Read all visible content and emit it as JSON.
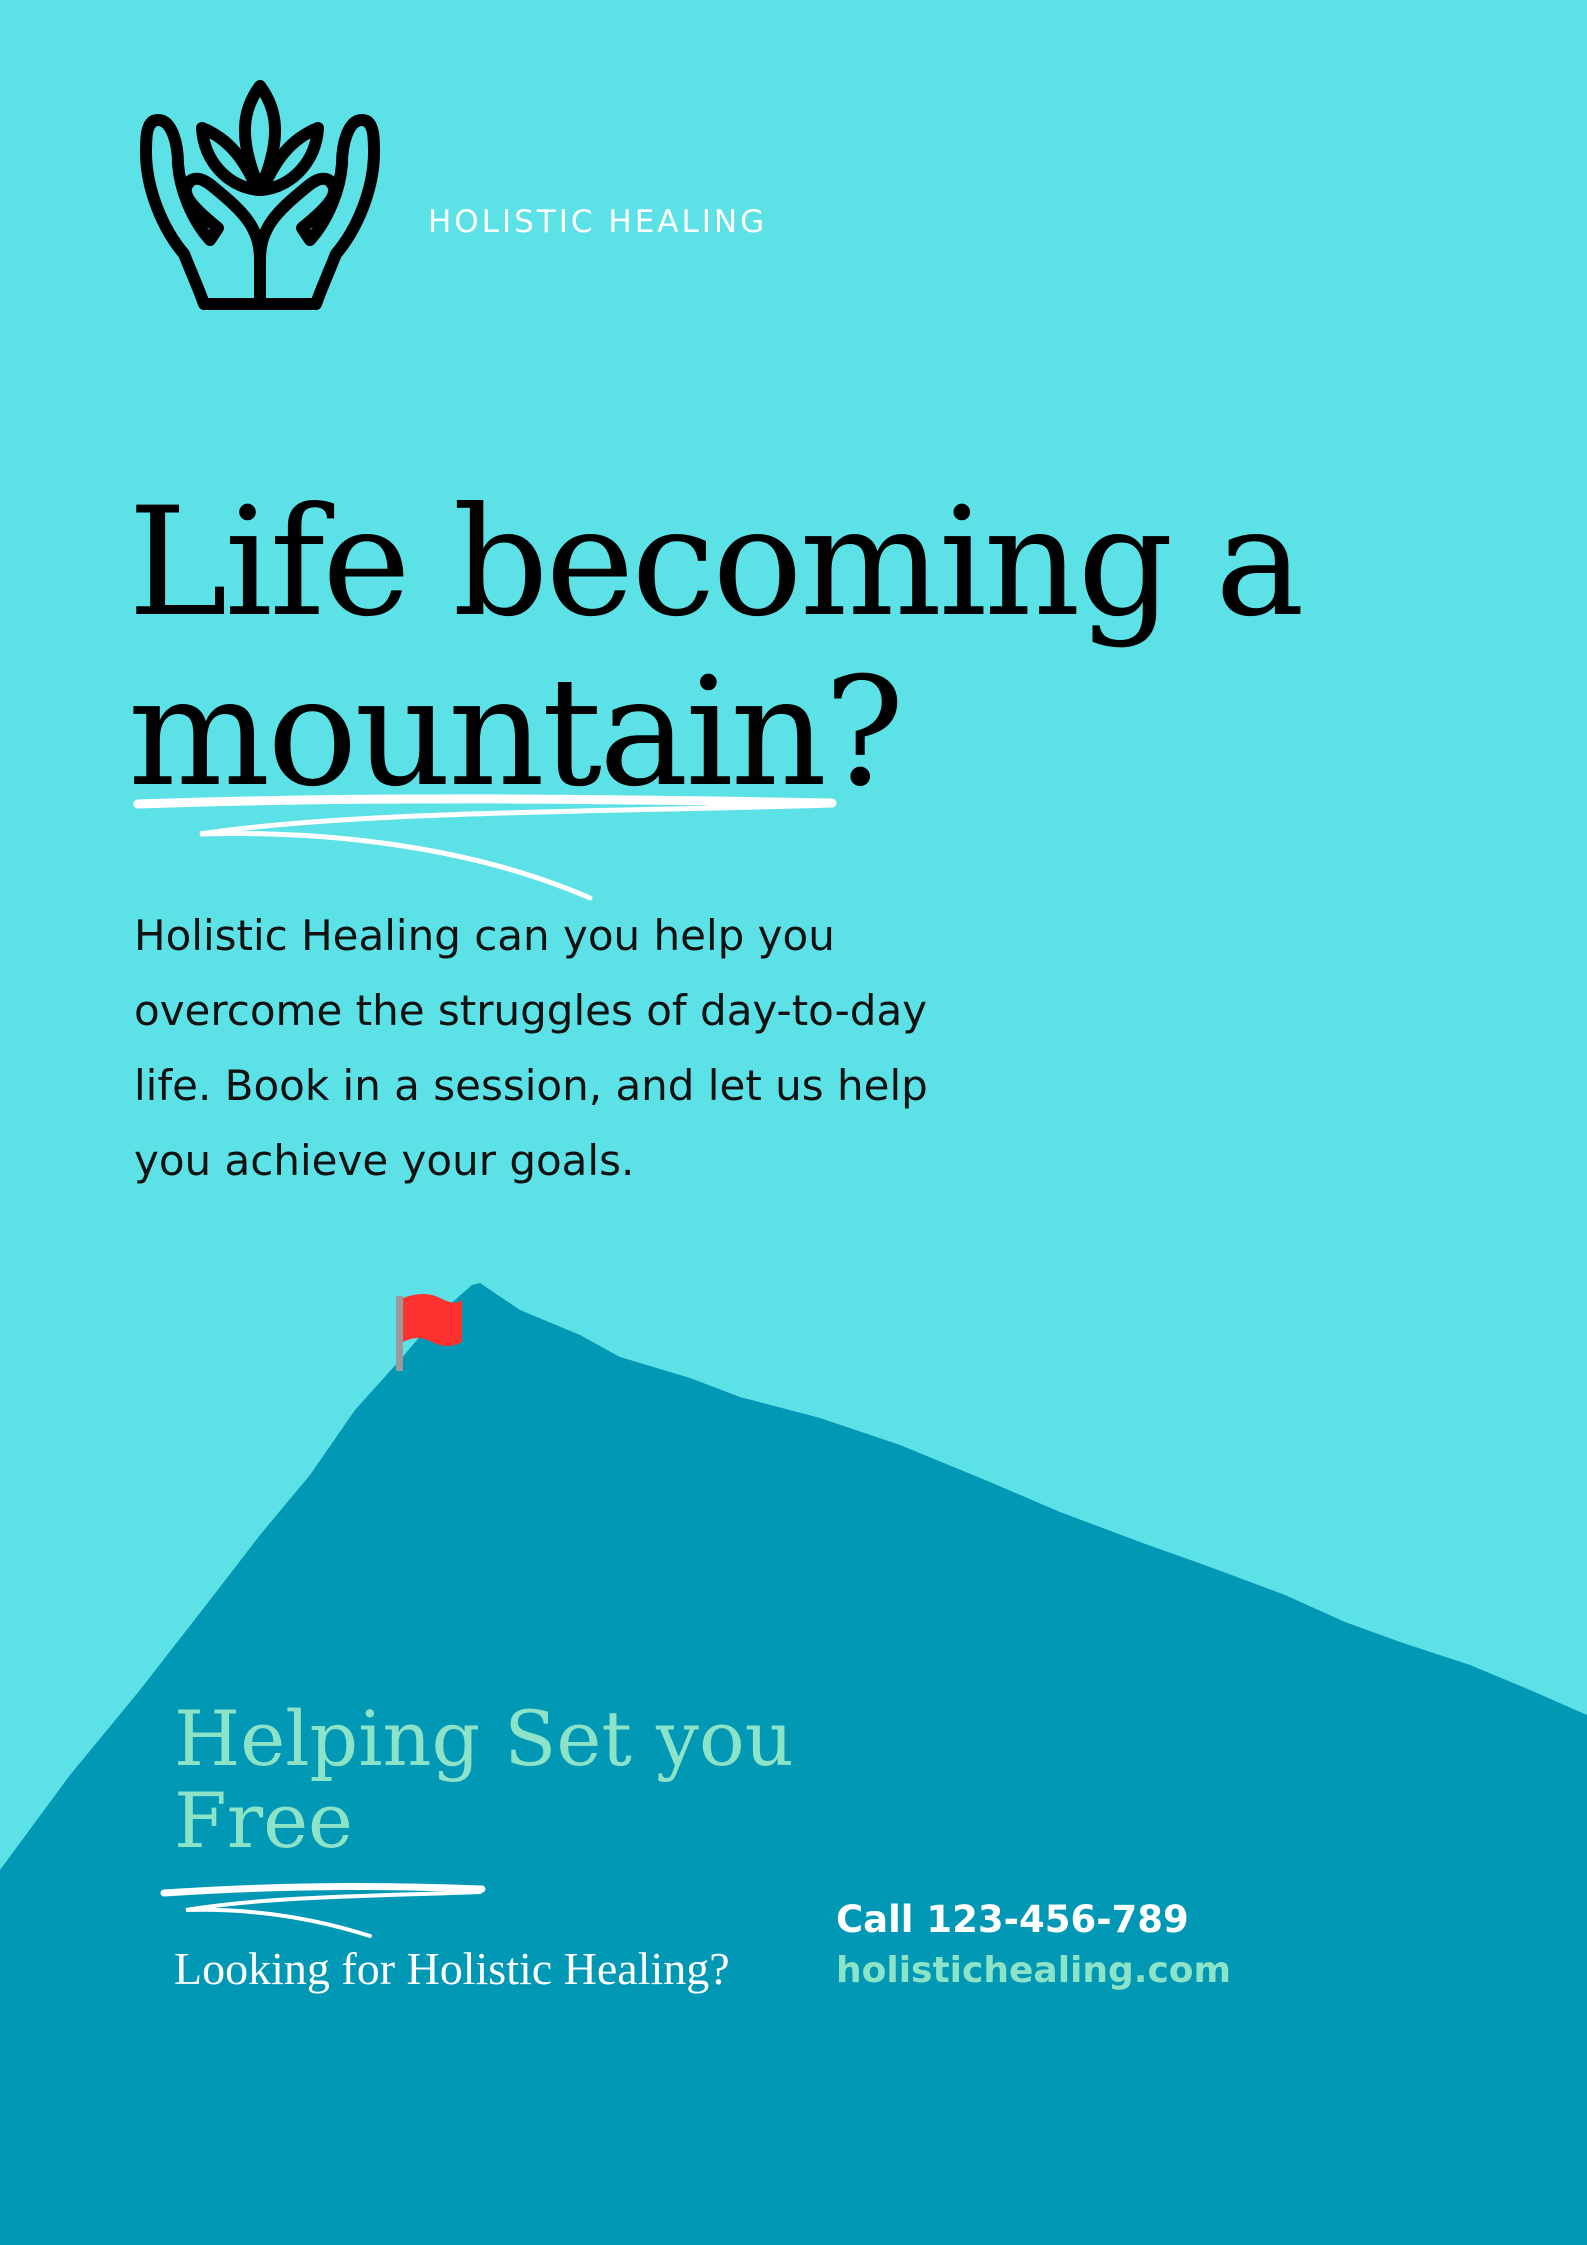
{
  "brand": {
    "name": "HOLISTIC HEALING",
    "logo_icon": "hands-lotus-icon"
  },
  "headline": {
    "line1": "Life becoming a",
    "line2": "mountain?"
  },
  "body": {
    "line1": "Holistic Healing can you help you",
    "line2": "overcome the struggles of day-to-day",
    "line3": "life. Book in a session, and let us help",
    "line4": "you achieve your goals."
  },
  "footer": {
    "subhead_line1": "Helping Set you",
    "subhead_line2": "Free",
    "question": "Looking for Holistic Healing?",
    "phone": "Call 123-456-789",
    "website": "holistichealing.com"
  },
  "colors": {
    "background": "#5CE1E6",
    "mountain": "#0098B4",
    "flag": "#FF3131",
    "accent_mint": "#8DE3C7",
    "text_dark": "#000000",
    "text_light": "#FFFFFF"
  }
}
